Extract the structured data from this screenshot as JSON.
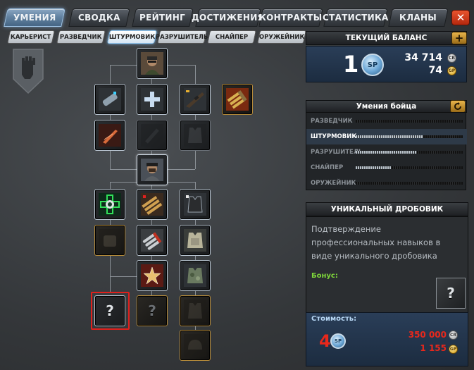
{
  "tabs": [
    "УМЕНИЯ",
    "СВОДКА",
    "РЕЙТИНГ",
    "ДОСТИЖЕНИЯ",
    "КОНТРАКТЫ",
    "СТАТИСТИКА",
    "КЛАНЫ"
  ],
  "active_tab": "УМЕНИЯ",
  "close_label": "✕",
  "sub_tabs": [
    "КАРЬЕРИСТ",
    "РАЗВЕДЧИК",
    "ШТУРМОВИК",
    "РАЗРУШИТЕЛЬ",
    "СНАЙПЕР",
    "ОРУЖЕЙНИК"
  ],
  "active_sub_tab": "ШТУРМОВИК",
  "balance": {
    "title": "ТЕКУЩИЙ БАЛАНС",
    "sp_value": "1",
    "sp_badge": "SP",
    "cr_value": "34 714",
    "cr_badge": "CR",
    "gp_value": "74",
    "gp_badge": "GP",
    "plus_label": "+"
  },
  "fighter_skills": {
    "title": "Умения бойца",
    "rows": [
      {
        "name": "РАЗВЕДЧИК",
        "progress": 0.0
      },
      {
        "name": "ШТУРМОВИК",
        "progress": 0.63
      },
      {
        "name": "РАЗРУШИТЕЛЬ",
        "progress": 0.57
      },
      {
        "name": "СНАЙПЕР",
        "progress": 0.33
      },
      {
        "name": "ОРУЖЕЙНИК",
        "progress": 0.0
      }
    ],
    "active_row": "ШТУРМОВИК"
  },
  "unique_item": {
    "title": "УНИКАЛЬНЫЙ ДРОБОВИК",
    "description": "Подтверждение профессиональных навыков в виде уникального дробовика",
    "bonus_label": "Бонус:",
    "bonus_icon": "?",
    "cost_label": "Стоимость:",
    "cost_sp": "4",
    "cost_sp_badge": "SP",
    "cost_cr": "350 000",
    "cost_cr_badge": "CR",
    "cost_gp": "1 155",
    "cost_gp_badge": "GP"
  },
  "tree_nodes": [
    {
      "name": "soldier-portrait-top",
      "icon": "soldier-icon",
      "state": "owned"
    },
    {
      "name": "silencer",
      "icon": "silencer-icon",
      "state": "owned"
    },
    {
      "name": "medkit-plus",
      "icon": "plus-icon",
      "state": "owned"
    },
    {
      "name": "rifle",
      "icon": "rifle-icon",
      "state": "owned"
    },
    {
      "name": "ammo-gold",
      "icon": "ammo-icon",
      "state": "gold"
    },
    {
      "name": "blade",
      "icon": "blade-icon",
      "state": "owned"
    },
    {
      "name": "locked-dim-1",
      "icon": "lock-icon",
      "state": "dim"
    },
    {
      "name": "vest-dim",
      "icon": "vest-icon",
      "state": "dim"
    },
    {
      "name": "soldier-portrait-mid",
      "icon": "soldier-icon",
      "state": "owned"
    },
    {
      "name": "medic-cross",
      "icon": "medic-icon",
      "state": "owned"
    },
    {
      "name": "ammo-belt",
      "icon": "ammo-icon",
      "state": "owned"
    },
    {
      "name": "vest",
      "icon": "vest-icon",
      "state": "owned"
    },
    {
      "name": "gear-dim",
      "icon": "gear-icon",
      "state": "gold-dim"
    },
    {
      "name": "rockets",
      "icon": "rockets-icon",
      "state": "owned"
    },
    {
      "name": "armor-plate",
      "icon": "armor-icon",
      "state": "owned"
    },
    {
      "name": "star-badge",
      "icon": "star-icon",
      "state": "owned"
    },
    {
      "name": "camo-vest",
      "icon": "vest-icon",
      "state": "owned"
    },
    {
      "name": "unique-shotgun",
      "icon": "question-icon",
      "state": "selected",
      "label": "?"
    },
    {
      "name": "unknown-locked",
      "icon": "question-icon",
      "state": "dim",
      "label": "?"
    },
    {
      "name": "vest-dim-2",
      "icon": "vest-icon",
      "state": "gold-dim"
    },
    {
      "name": "helmet-dim",
      "icon": "helmet-icon",
      "state": "gold-dim"
    }
  ]
}
